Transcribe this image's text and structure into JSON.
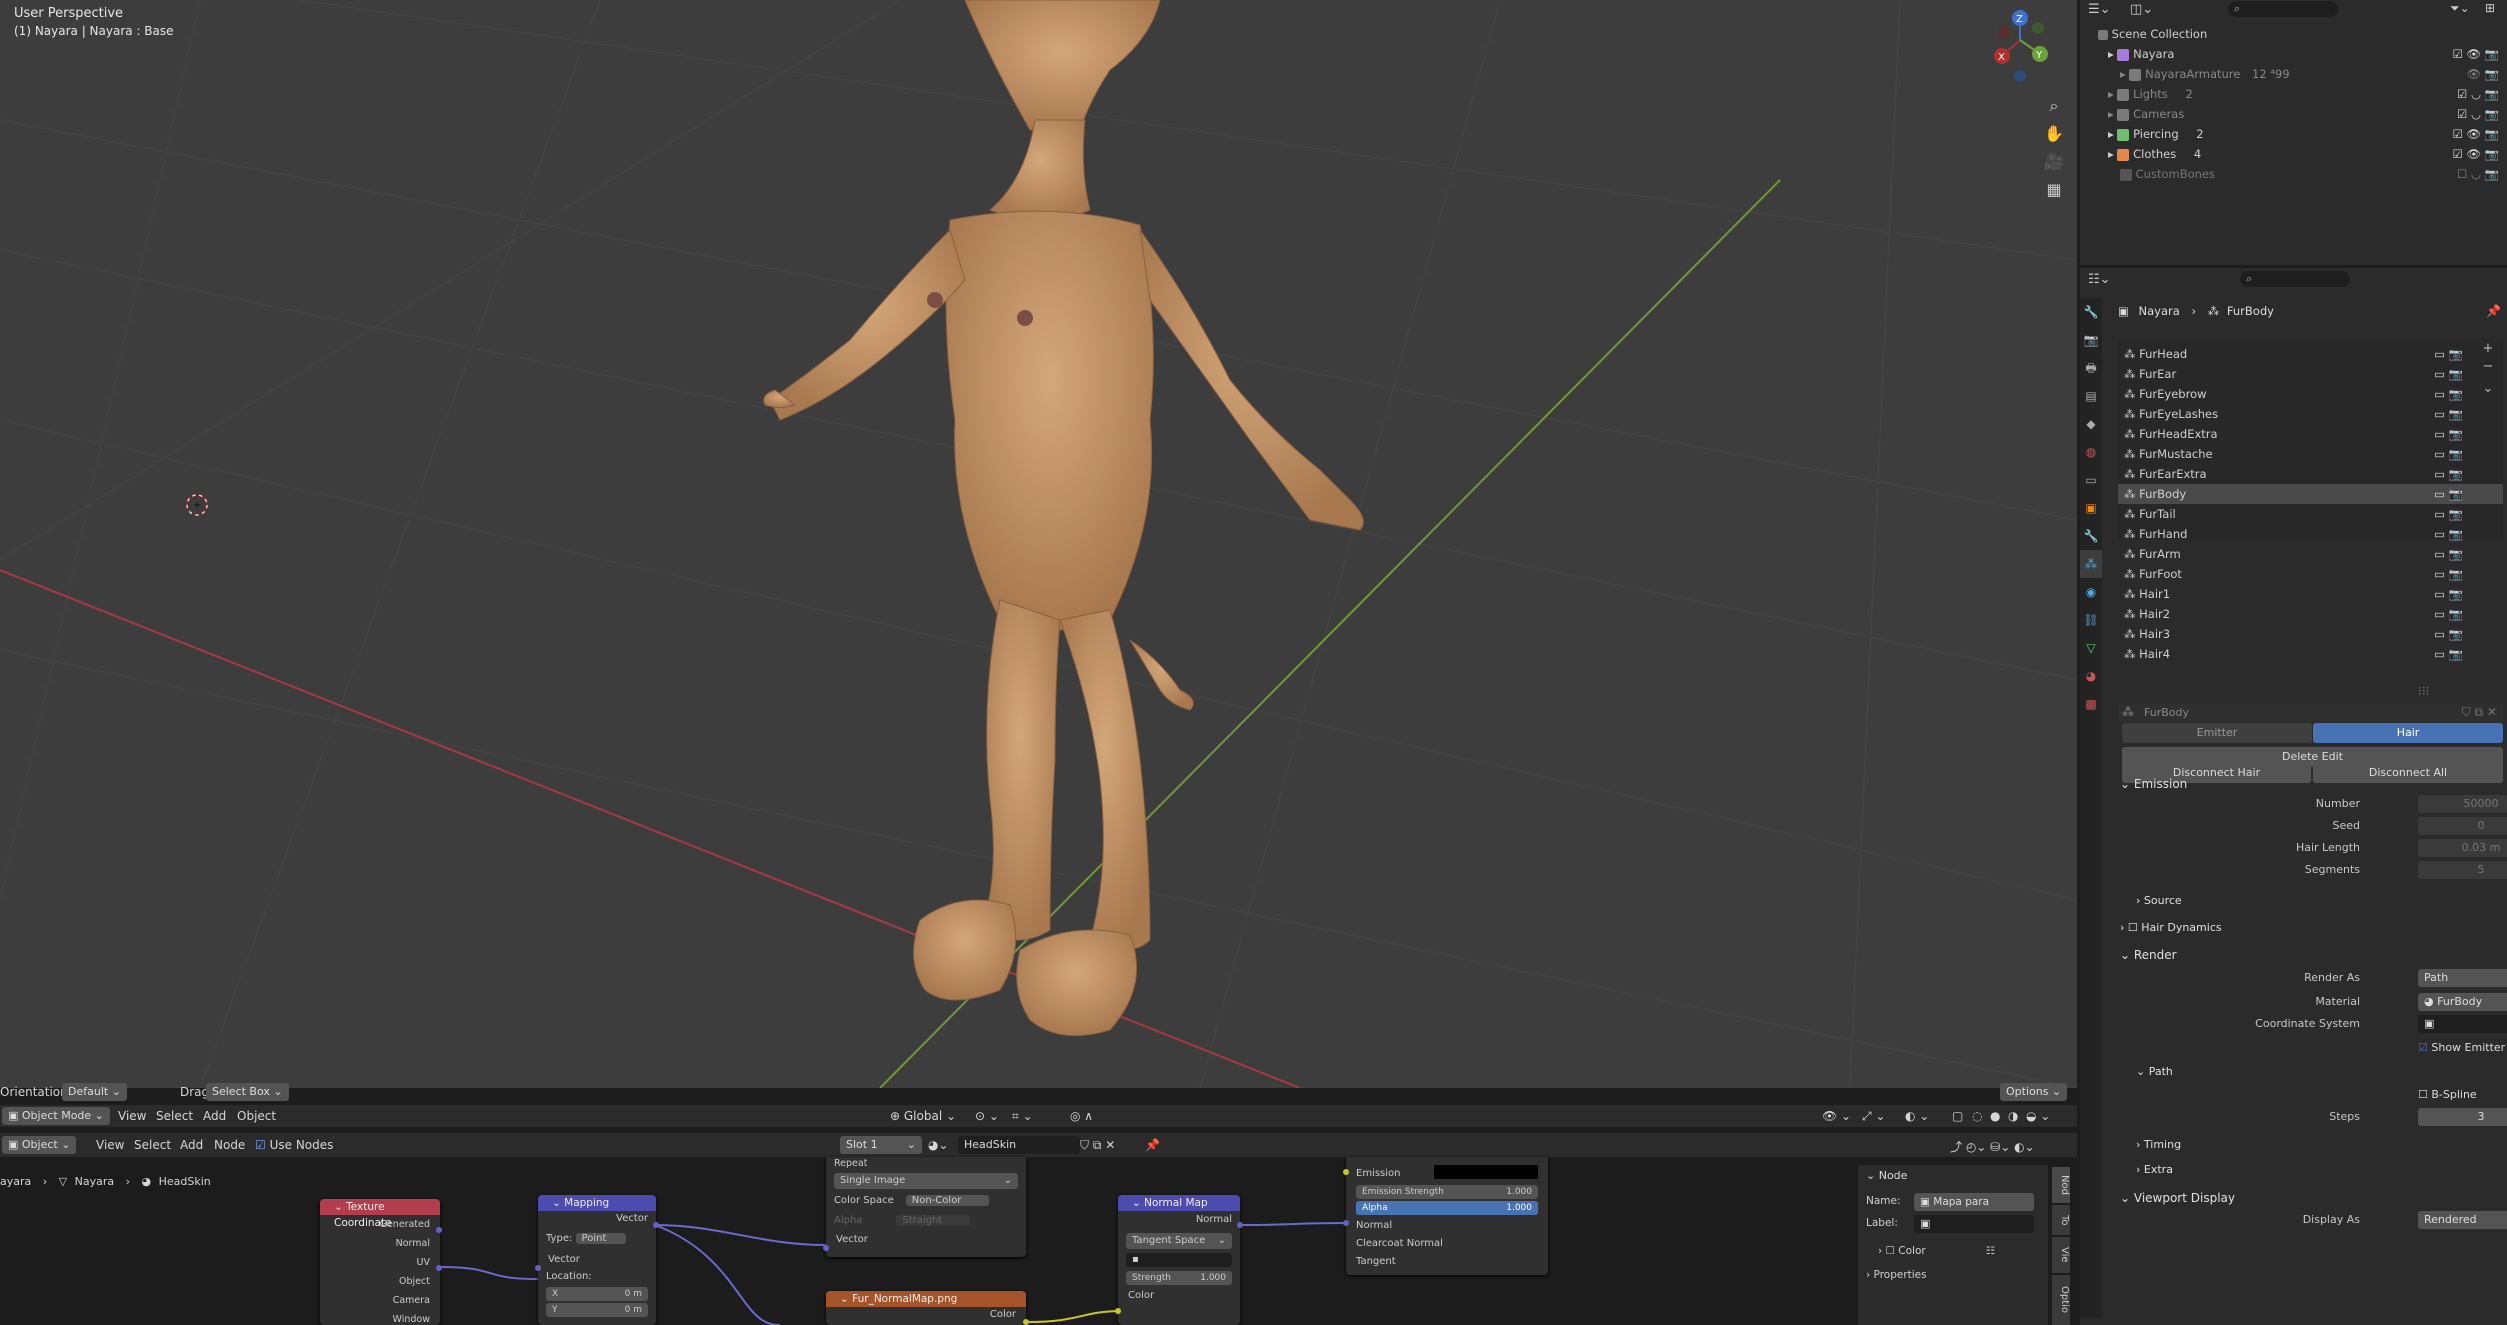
{
  "viewport": {
    "perspective_label": "User Perspective",
    "object_label": "(1) Nayara | Nayara : Base",
    "orientation_label": "Orientation:",
    "orientation_value": "Default",
    "drag_label": "Drag:",
    "drag_value": "Select Box",
    "options_label": "Options",
    "mode": "Object Mode",
    "menu": [
      "View",
      "Select",
      "Add",
      "Object"
    ],
    "transform_space": "Global"
  },
  "outliner": {
    "root": "Scene Collection",
    "items": [
      {
        "label": "Nayara",
        "color": "#a77bd8"
      },
      {
        "label": "NayaraArmature",
        "color": "#7a7a7a",
        "extra": "12 ⁴99"
      },
      {
        "label": "Lights",
        "color": "#7a7a7a",
        "extra": "2"
      },
      {
        "label": "Cameras",
        "color": "#7a7a7a"
      },
      {
        "label": "Piercing",
        "color": "#6fbf6f",
        "extra": "2"
      },
      {
        "label": "Clothes",
        "color": "#e38a4a",
        "extra": "4"
      },
      {
        "label": "CustomBones",
        "color": "#7a7a7a"
      }
    ]
  },
  "properties": {
    "breadcrumb_object": "Nayara",
    "breadcrumb_system": "FurBody",
    "particle_systems": [
      "FurHead",
      "FurEar",
      "FurEyebrow",
      "FurEyeLashes",
      "FurHeadExtra",
      "FurMustache",
      "FurEarExtra",
      "FurBody",
      "FurTail",
      "FurHand",
      "FurArm",
      "FurFoot",
      "Hair1",
      "Hair2",
      "Hair3",
      "Hair4"
    ],
    "selected_system": "FurBody",
    "settings_name": "FurBody",
    "tab_emitter": "Emitter",
    "tab_hair": "Hair",
    "delete_edit": "Delete Edit",
    "disconnect_hair": "Disconnect Hair",
    "disconnect_all": "Disconnect All",
    "emission": {
      "title": "Emission",
      "number_label": "Number",
      "number_value": "50000",
      "seed_label": "Seed",
      "seed_value": "0",
      "hair_length_label": "Hair Length",
      "hair_length_value": "0.03 m",
      "segments_label": "Segments",
      "segments_value": "5",
      "source_label": "Source"
    },
    "hair_dynamics": "Hair Dynamics",
    "render": {
      "title": "Render",
      "render_as_label": "Render As",
      "render_as_value": "Path",
      "material_label": "Material",
      "material_value": "FurBody",
      "coord_system_label": "Coordinate System",
      "show_emitter": "Show Emitter",
      "path_label": "Path",
      "bspline_label": "B-Spline",
      "steps_label": "Steps",
      "steps_value": "3",
      "timing_label": "Timing",
      "extra_label": "Extra"
    },
    "viewport_display": {
      "title": "Viewport Display",
      "display_as_label": "Display As",
      "display_as_value": "Rendered"
    }
  },
  "node_editor": {
    "editor_type": "Object",
    "menu": [
      "View",
      "Select",
      "Add",
      "Node"
    ],
    "use_nodes": "Use Nodes",
    "slot": "Slot 1",
    "material": "HeadSkin",
    "breadcrumb": [
      "ayara",
      "Nayara",
      "HeadSkin"
    ],
    "nodes": {
      "texcoord": {
        "title": "Texture Coordinate",
        "outputs": [
          "Generated",
          "Normal",
          "UV",
          "Object",
          "Camera",
          "Window"
        ]
      },
      "mapping": {
        "title": "Mapping",
        "output": "Vector",
        "type_label": "Type:",
        "type_value": "Point",
        "input_vector": "Vector",
        "location": "Location:",
        "x_label": "X",
        "x_value": "0 m",
        "y_label": "Y",
        "y_value": "0 m"
      },
      "image": {
        "repeat": "Repeat",
        "source": "Single Image",
        "cs_label": "Color Space",
        "cs_value": "Non-Color",
        "alpha_label": "Alpha",
        "alpha_value": "Straight",
        "vector": "Vector"
      },
      "image2": {
        "title": "Fur_NormalMap.png",
        "color": "Color"
      },
      "normalmap": {
        "title": "Normal Map",
        "output": "Normal",
        "space": "Tangent Space",
        "strength_label": "Strength",
        "strength_value": "1.000",
        "color": "Color"
      },
      "bsdf": {
        "emission": "Emission",
        "emission_strength": "Emission Strength",
        "es_value": "1.000",
        "alpha": "Alpha",
        "alpha_value": "1.000",
        "normal": "Normal",
        "clearcoat_normal": "Clearcoat Normal",
        "tangent": "Tangent"
      }
    },
    "sidebar": {
      "title": "Node",
      "name_label": "Name:",
      "name_value": "Mapa para normais",
      "label_label": "Label:",
      "color_label": "Color",
      "properties_label": "Properties",
      "tabs": [
        "Nod",
        "To",
        "Vie",
        "Optio"
      ]
    }
  }
}
